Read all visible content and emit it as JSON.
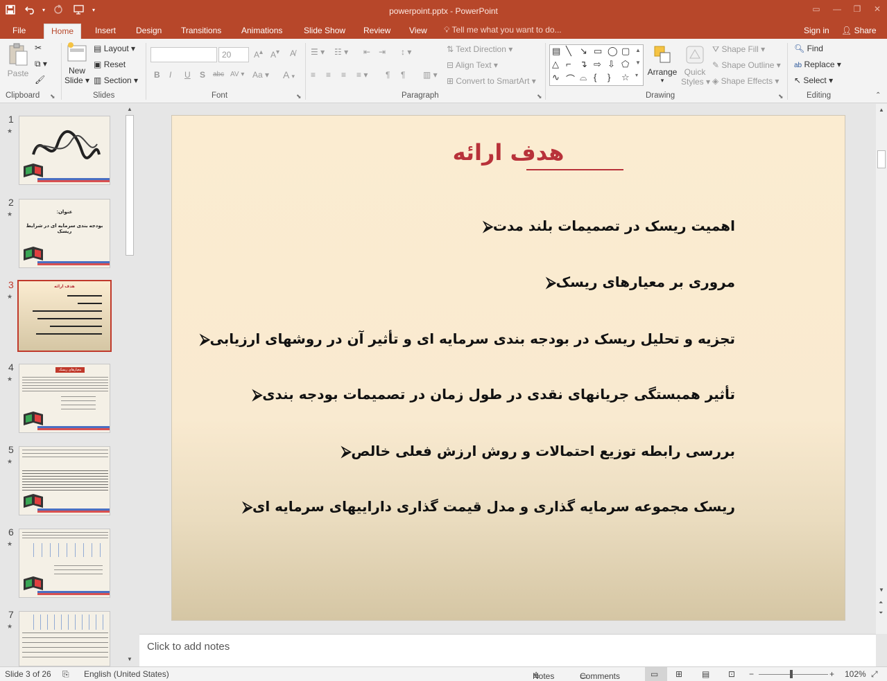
{
  "window": {
    "title": "powerpoint.pptx - PowerPoint",
    "colors": {
      "accent": "#b7472a",
      "title_red": "#b8323a",
      "slide_bg": "#fbecd1"
    }
  },
  "quick_access": {
    "save_icon": "save-icon",
    "undo_icon": "undo-icon",
    "redo_icon": "redo-icon",
    "present_icon": "present-from-start-icon",
    "customize_icon": "customize-icon"
  },
  "tabs": [
    {
      "label": "File"
    },
    {
      "label": "Home",
      "active": true
    },
    {
      "label": "Insert"
    },
    {
      "label": "Design"
    },
    {
      "label": "Transitions"
    },
    {
      "label": "Animations"
    },
    {
      "label": "Slide Show"
    },
    {
      "label": "Review"
    },
    {
      "label": "View"
    }
  ],
  "tell_me": "Tell me what you want to do...",
  "account": {
    "sign_in": "Sign in",
    "share": "Share"
  },
  "ribbon": {
    "clipboard": {
      "label": "Clipboard",
      "paste": "Paste"
    },
    "slides": {
      "label": "Slides",
      "new_slide": "New",
      "new_slide_2": "Slide",
      "layout": "Layout",
      "reset": "Reset",
      "section": "Section"
    },
    "font": {
      "label": "Font",
      "font_name": "",
      "font_size": "20",
      "bold": "B",
      "italic": "I",
      "underline": "U",
      "shadow": "S",
      "strike": "abc",
      "spacing": "AV",
      "case": "Aa",
      "color": "A"
    },
    "paragraph": {
      "label": "Paragraph",
      "text_direction": "Text Direction",
      "align_text": "Align Text",
      "smartart": "Convert to SmartArt"
    },
    "drawing": {
      "label": "Drawing",
      "arrange": "Arrange",
      "quick_styles": "Quick",
      "quick_styles_2": "Styles",
      "shape_fill": "Shape Fill",
      "shape_outline": "Shape Outline",
      "shape_effects": "Shape Effects"
    },
    "editing": {
      "label": "Editing",
      "find": "Find",
      "replace": "Replace",
      "select": "Select"
    }
  },
  "thumbnails": [
    {
      "num": "1",
      "active": false,
      "text1": "",
      "text2": ""
    },
    {
      "num": "2",
      "active": false,
      "text1": "عنوان:",
      "text2": "بودجه بندی سرمایه ای در شرایط ریسک"
    },
    {
      "num": "3",
      "active": true,
      "text1": "هدف ارائه",
      "text2": ""
    },
    {
      "num": "4",
      "active": false,
      "text1": "معیارهای ریسک",
      "text2": ""
    },
    {
      "num": "5",
      "active": false,
      "text1": "",
      "text2": ""
    },
    {
      "num": "6",
      "active": false,
      "text1": "",
      "text2": ""
    },
    {
      "num": "7",
      "active": false,
      "text1": "",
      "text2": ""
    }
  ],
  "slide": {
    "title": "هدف ارائه",
    "bullets": [
      "اهمیت ریسک در تصمیمات بلند مدت",
      "مروری بر معیارهای ریسک",
      "تجزیه و تحلیل ریسک در بودجه بندی سرمایه ای و تأثیر آن در روشهای ارزیابی",
      "تأثیر همبستگی جریانهای نقدی در طول زمان در تصمیمات بودجه بندی",
      "بررسی رابطه توزیع احتمالات و روش ارزش فعلی خالص",
      "ریسک مجموعه سرمایه گذاری و مدل قیمت گذاری داراییهای سرمایه ای"
    ]
  },
  "notes_placeholder": "Click to add notes",
  "status": {
    "slide_info": "Slide 3 of 26",
    "language": "English (United States)",
    "notes": "Notes",
    "comments": "Comments",
    "zoom": "102%"
  }
}
